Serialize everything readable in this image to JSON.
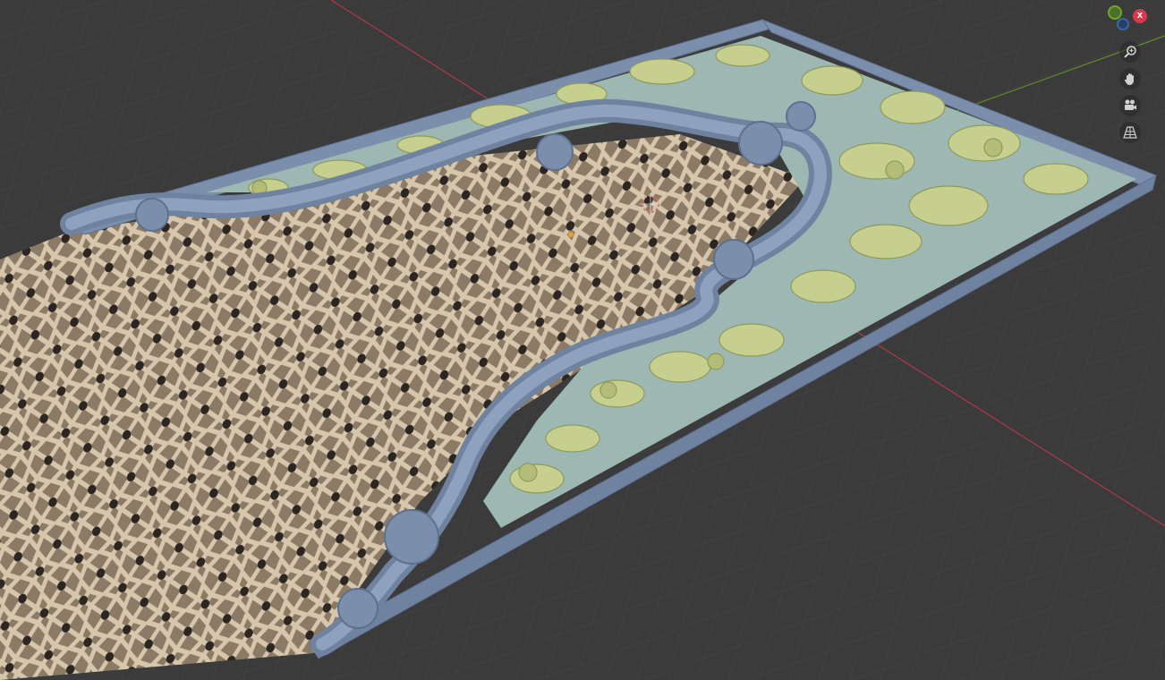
{
  "viewport": {
    "background_color": "#3b3b3b",
    "grid_color": "#4a4a4a",
    "x_axis_color": "#c0394a",
    "y_axis_color": "#6d9a2d",
    "model_frame_color": "#7b8fad",
    "model_carving_color": "#c6cf8d",
    "model_inset_color": "#8fb3ac",
    "reference_image": "geometric-lattice-pattern"
  },
  "gizmo": {
    "x_label": "X",
    "colors": {
      "x": "#d8394f",
      "y": "#6aa82a",
      "z": "#3a66a8"
    }
  },
  "nav_buttons": [
    {
      "icon": "zoom-icon"
    },
    {
      "icon": "hand-pan-icon"
    },
    {
      "icon": "camera-icon"
    },
    {
      "icon": "grid-perspective-icon"
    }
  ]
}
